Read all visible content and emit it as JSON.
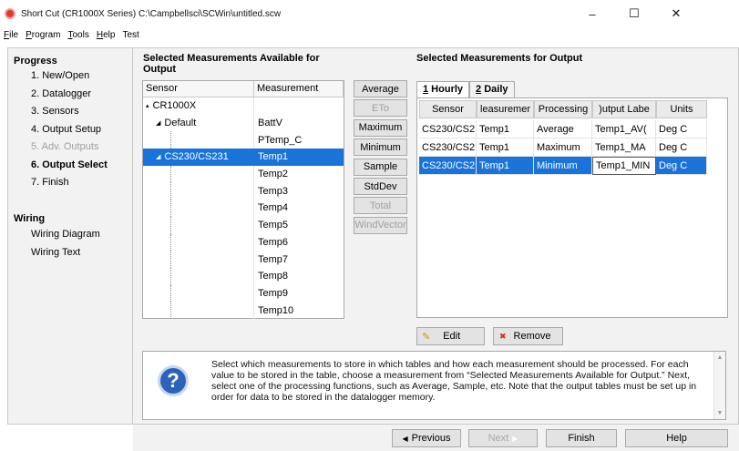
{
  "window": {
    "title": "Short Cut (CR1000X Series) C:\\Campbellsci\\SCWin\\untitled.scw",
    "minimize": "–",
    "maximize": "☐",
    "close": "✕"
  },
  "menu": [
    {
      "ul": "F",
      "rest": "ile"
    },
    {
      "ul": "P",
      "rest": "rogram"
    },
    {
      "ul": "T",
      "rest": "ools"
    },
    {
      "ul": "H",
      "rest": "elp"
    },
    {
      "ul": "",
      "rest": "Test"
    }
  ],
  "sidebar": {
    "progress_title": "Progress",
    "items": [
      "1. New/Open",
      "2. Datalogger",
      "3. Sensors",
      "4. Output Setup",
      "5. Adv. Outputs",
      "6. Output Select",
      "7. Finish"
    ],
    "wiring_title": "Wiring",
    "wiring_items": [
      "Wiring Diagram",
      "Wiring Text"
    ]
  },
  "left_heading": "Selected Measurements Available for Output",
  "right_heading": "Selected Measurements for Output",
  "tree": {
    "col_sensor": "Sensor",
    "col_measurement": "Measurement",
    "rows": [
      {
        "sensor": "CR1000X",
        "measurement": "",
        "level": 0,
        "expander": "▴"
      },
      {
        "sensor": "Default",
        "measurement": "BattV",
        "level": 1,
        "expander": "◢"
      },
      {
        "sensor": "",
        "measurement": "PTemp_C",
        "level": 2
      },
      {
        "sensor": "CS230/CS231",
        "measurement": "Temp1",
        "level": 1,
        "expander": "◢",
        "selected": true
      },
      {
        "sensor": "",
        "measurement": "Temp2",
        "level": 2
      },
      {
        "sensor": "",
        "measurement": "Temp3",
        "level": 2
      },
      {
        "sensor": "",
        "measurement": "Temp4",
        "level": 2
      },
      {
        "sensor": "",
        "measurement": "Temp5",
        "level": 2
      },
      {
        "sensor": "",
        "measurement": "Temp6",
        "level": 2
      },
      {
        "sensor": "",
        "measurement": "Temp7",
        "level": 2
      },
      {
        "sensor": "",
        "measurement": "Temp8",
        "level": 2
      },
      {
        "sensor": "",
        "measurement": "Temp9",
        "level": 2
      },
      {
        "sensor": "",
        "measurement": "Temp10",
        "level": 2
      }
    ]
  },
  "functions": [
    {
      "label": "Average",
      "enabled": true
    },
    {
      "label": "ETo",
      "enabled": false
    },
    {
      "label": "Maximum",
      "enabled": true
    },
    {
      "label": "Minimum",
      "enabled": true
    },
    {
      "label": "Sample",
      "enabled": true
    },
    {
      "label": "StdDev",
      "enabled": true
    },
    {
      "label": "Total",
      "enabled": false
    },
    {
      "label": "WindVector",
      "enabled": false
    }
  ],
  "tabs": [
    {
      "ul": "1",
      "rest": " Hourly",
      "active": true
    },
    {
      "ul": "2",
      "rest": " Daily",
      "active": false
    }
  ],
  "output": {
    "cols": [
      "Sensor",
      "leasuremer",
      "Processing",
      ")utput Labe",
      "Units"
    ],
    "rows": [
      {
        "sensor": "CS230/CS2",
        "measurement": "Temp1",
        "processing": "Average",
        "label": "Temp1_AV(",
        "units": "Deg C"
      },
      {
        "sensor": "CS230/CS2",
        "measurement": "Temp1",
        "processing": "Maximum",
        "label": "Temp1_MA",
        "units": "Deg C"
      },
      {
        "sensor": "CS230/CS2",
        "measurement": "Temp1",
        "processing": "Minimum",
        "label": "Temp1_MIN",
        "units": "Deg C",
        "selected": true
      }
    ]
  },
  "edit_label": "Edit",
  "remove_label": "Remove",
  "help_text": "Select which measurements to store in which tables and how each measurement should be processed. For each value to be stored in the table, choose a measurement from “Selected Measurements Available for Output.”  Next, select one of the processing functions, such as Average, Sample, etc.  Note that the output tables must be set up in order for data to be stored in the datalogger memory.",
  "help_icon": "?",
  "nav": {
    "previous": "Previous",
    "next": "Next",
    "finish": "Finish",
    "help": "Help"
  }
}
